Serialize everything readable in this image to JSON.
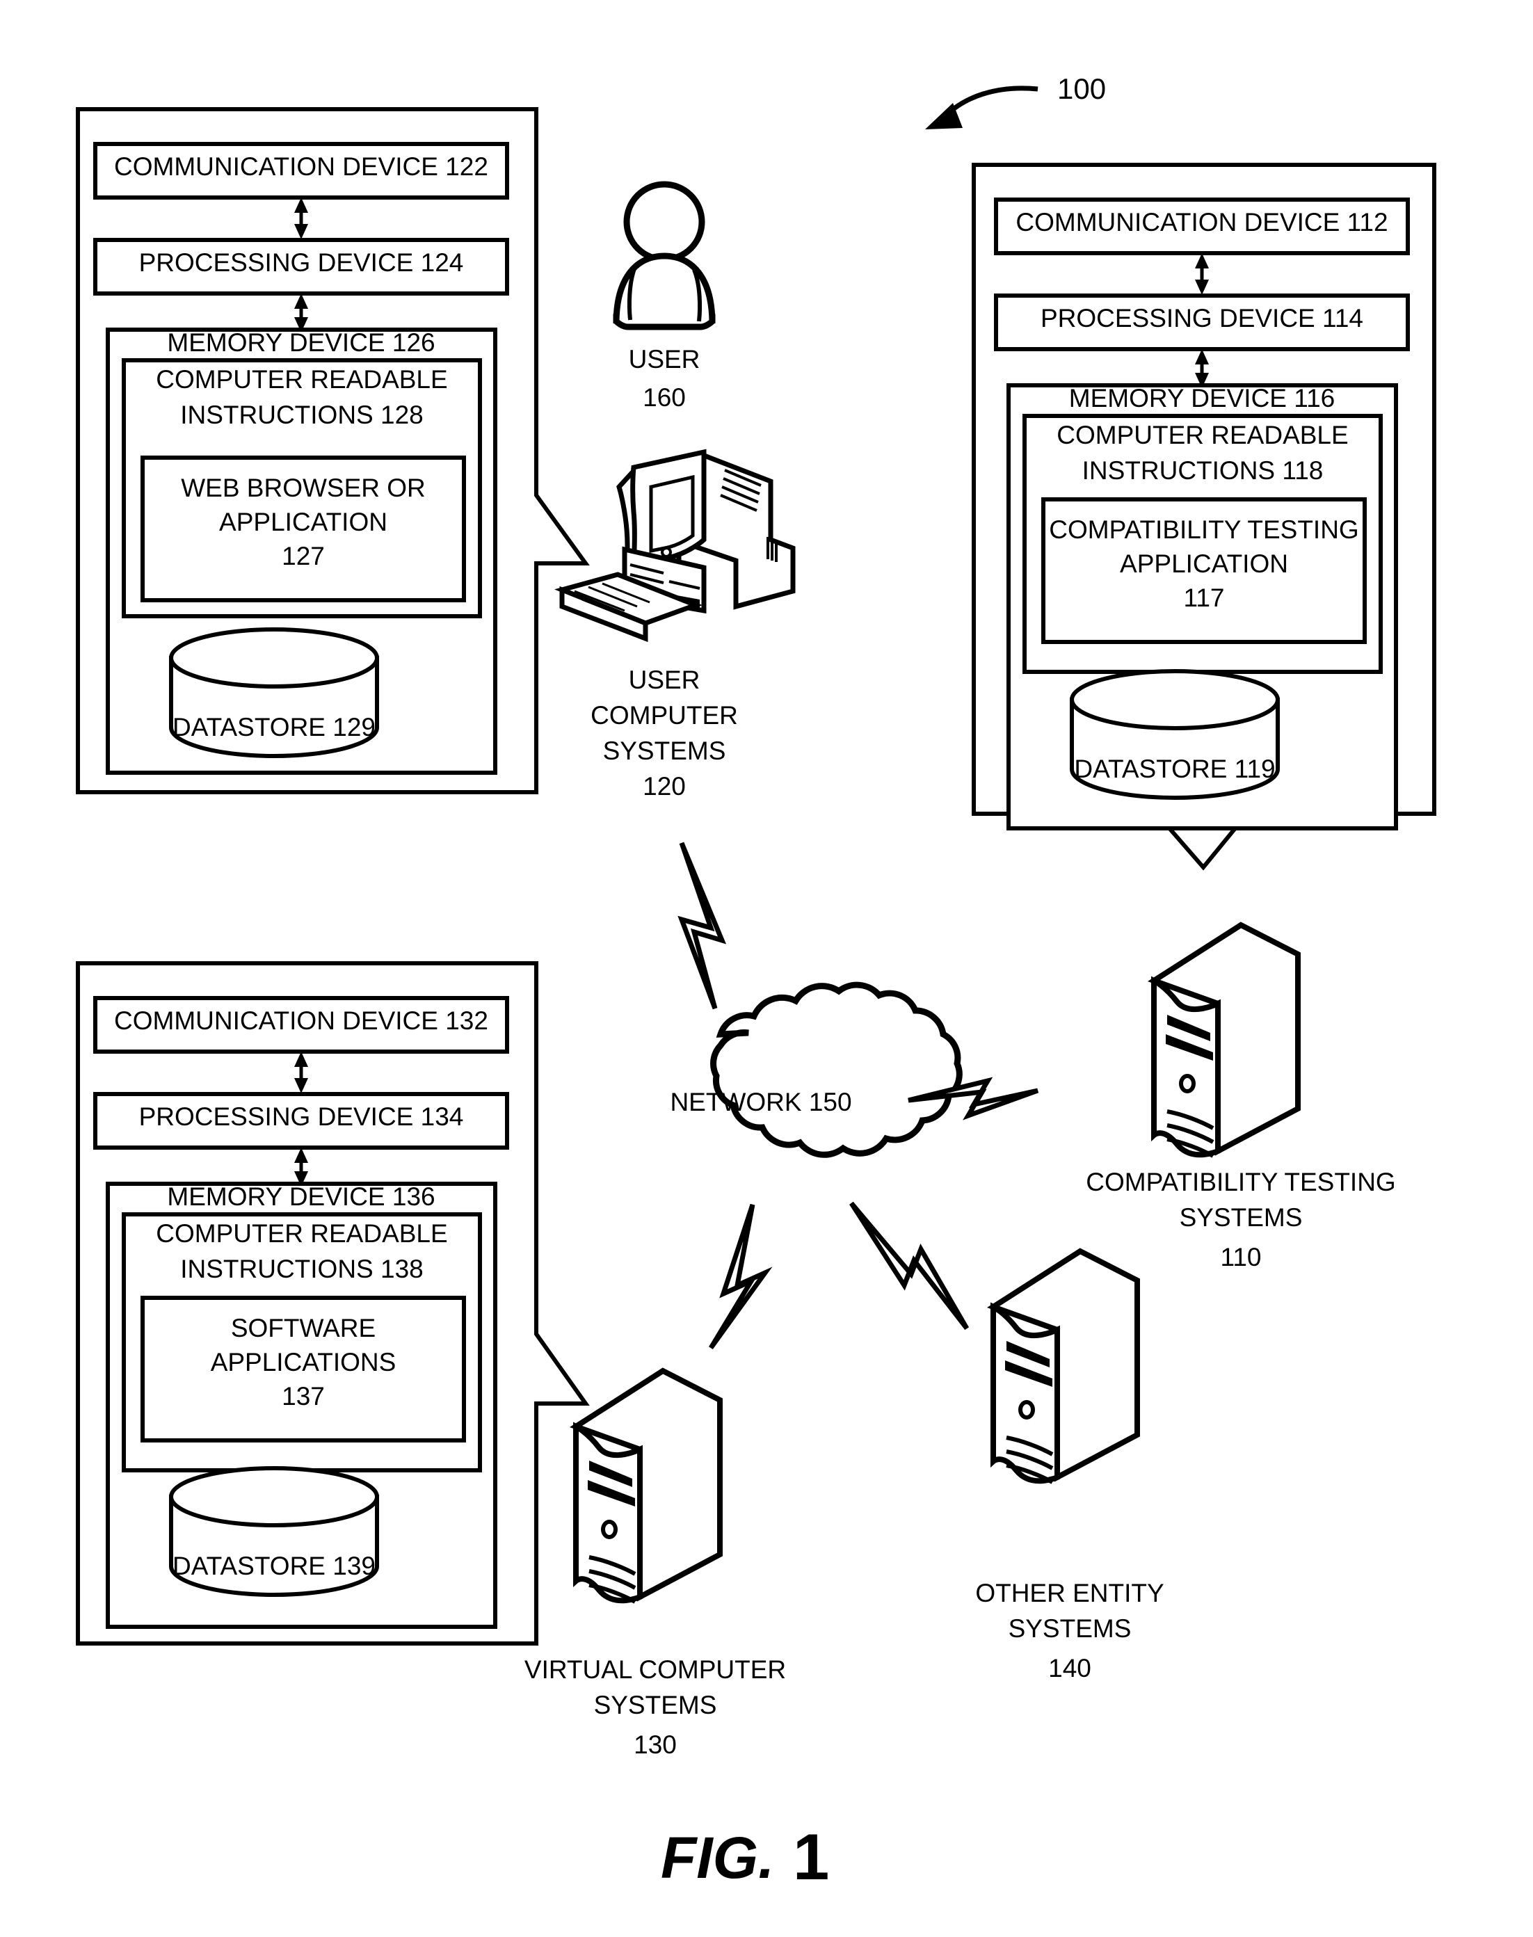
{
  "figure": {
    "caption_prefix": "FIG.",
    "caption_number": "1",
    "system_reference": "100"
  },
  "user_computer_systems": {
    "panel_label": "USER COMPUTER SYSTEMS",
    "boxes": {
      "communication_device": "COMMUNICATION DEVICE 122",
      "processing_device": "PROCESSING DEVICE 124",
      "memory_device": "MEMORY DEVICE 126",
      "computer_readable_instructions_line1": "COMPUTER READABLE",
      "computer_readable_instructions_line2": "INSTRUCTIONS 128",
      "application_line1": "WEB BROWSER OR",
      "application_line2": "APPLICATION",
      "application_ref": "127",
      "datastore": "DATASTORE 129"
    },
    "icon_label_line1": "USER",
    "icon_label_line2": "COMPUTER",
    "icon_label_line3": "SYSTEMS",
    "icon_ref": "120",
    "icon_name": "desktop-computer-icon"
  },
  "user": {
    "label": "USER",
    "ref": "160",
    "icon_name": "person-icon"
  },
  "compatibility_testing_systems": {
    "boxes": {
      "communication_device": "COMMUNICATION DEVICE 112",
      "processing_device": "PROCESSING DEVICE 114",
      "memory_device": "MEMORY DEVICE 116",
      "computer_readable_instructions_line1": "COMPUTER READABLE",
      "computer_readable_instructions_line2": "INSTRUCTIONS 118",
      "application_line1": "COMPATIBILITY TESTING",
      "application_line2": "APPLICATION",
      "application_ref": "117",
      "datastore": "DATASTORE 119"
    },
    "icon_label_line1": "COMPATIBILITY TESTING",
    "icon_label_line2": "SYSTEMS",
    "icon_ref": "110",
    "icon_name": "server-tower-icon"
  },
  "virtual_computer_systems": {
    "boxes": {
      "communication_device": "COMMUNICATION DEVICE 132",
      "processing_device": "PROCESSING DEVICE 134",
      "memory_device": "MEMORY DEVICE 136",
      "computer_readable_instructions_line1": "COMPUTER READABLE",
      "computer_readable_instructions_line2": "INSTRUCTIONS 138",
      "application_line1": "SOFTWARE",
      "application_line2": "APPLICATIONS",
      "application_ref": "137",
      "datastore": "DATASTORE 139"
    },
    "icon_label_line1": "VIRTUAL COMPUTER",
    "icon_label_line2": "SYSTEMS",
    "icon_ref": "130",
    "icon_name": "server-tower-icon"
  },
  "other_entity_systems": {
    "icon_label_line1": "OTHER ENTITY",
    "icon_label_line2": "SYSTEMS",
    "icon_ref": "140",
    "icon_name": "server-tower-icon"
  },
  "network": {
    "label": "NETWORK 150",
    "icon_name": "cloud-icon"
  },
  "colors": {
    "stroke": "#000000",
    "background": "#ffffff"
  }
}
